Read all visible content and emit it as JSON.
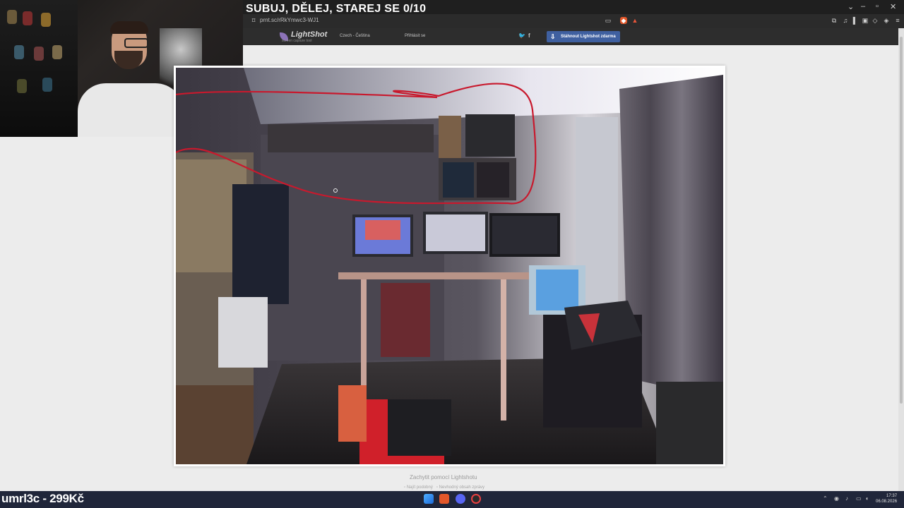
{
  "stream": {
    "title": "SUBUJ, DĚLEJ, STAREJ SE 0/10",
    "promo": "umrl3c - 299Kč"
  },
  "browser": {
    "url": "prnt.sc/rRkYmwc3-WJ1",
    "icons": [
      "bookmark-icon",
      "cast-icon",
      "brave-shield-icon",
      "alert-icon",
      "extension-icon",
      "music-icon",
      "sidebar-icon",
      "wallet-icon",
      "wallet-icon",
      "vpn-icon",
      "menu-icon"
    ]
  },
  "lightshot": {
    "logo": "LightShot",
    "tagline": "screen capture tool",
    "language": "Czech - Čeština",
    "login": "Přihlásit se",
    "download_label": "Stáhnout Lightshot zdarma",
    "footer": "Zachytit pomocí Lightshotu",
    "link_similar": "Najít podobný",
    "link_report": "Nevhodný obsah zprávy"
  },
  "taskbar": {
    "time": "17:37",
    "date": "06.08.2026"
  },
  "colors": {
    "lightshot_blue": "#3f60a0",
    "annotation_red": "#c8192d",
    "taskbar": "#20263a"
  }
}
